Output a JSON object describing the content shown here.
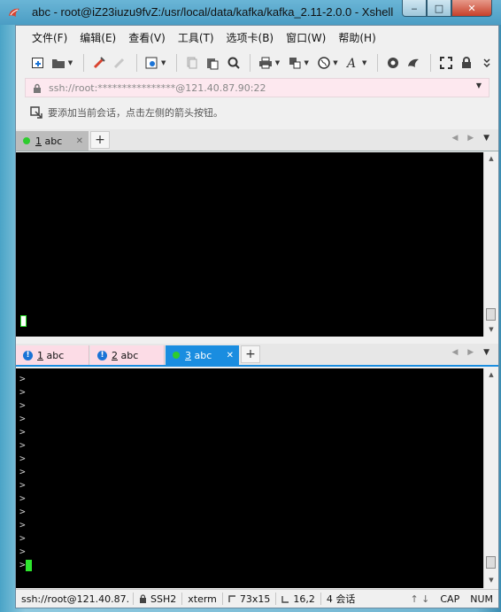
{
  "window": {
    "title": "abc - root@iZ23iuzu9fvZ:/usr/local/data/kafka/kafka_2.11-2.0.0 - Xshell",
    "buttons": {
      "minimize": "‒",
      "maximize": "□",
      "close": "✕"
    }
  },
  "menu": [
    "文件(F)",
    "编辑(E)",
    "查看(V)",
    "工具(T)",
    "选项卡(B)",
    "窗口(W)",
    "帮助(H)"
  ],
  "toolbar": {
    "icons": [
      "new-session-icon",
      "open-folder-icon",
      "reconnect-icon",
      "disconnect-icon",
      "properties-icon",
      "copy-icon",
      "paste-icon",
      "find-icon",
      "print-icon",
      "transfer-icon",
      "globe-icon",
      "font-icon",
      "xftp-icon",
      "xagent-icon",
      "fullscreen-icon",
      "lock-icon",
      "more-icon"
    ]
  },
  "address": {
    "value": "ssh://root:****************@121.40.87.90:22"
  },
  "hint": {
    "text": "要添加当前会话，点击左侧的箭头按钮。"
  },
  "top_pane": {
    "tabs": [
      {
        "number": "1",
        "label": "abc",
        "status": "connected"
      }
    ],
    "add_tab": "+"
  },
  "bottom_pane": {
    "tabs": [
      {
        "number": "1",
        "label": "abc",
        "status": "warning"
      },
      {
        "number": "2",
        "label": "abc",
        "status": "warning"
      },
      {
        "number": "3",
        "label": "abc",
        "status": "connected"
      }
    ],
    "add_tab": "+",
    "prompt_lines": [
      ">",
      ">",
      ">",
      ">",
      ">",
      ">",
      ">",
      ">",
      ">",
      ">",
      ">",
      ">",
      ">",
      ">",
      ">"
    ]
  },
  "status": {
    "connection": "ssh://root@121.40.87.",
    "protocol": "SSH2",
    "terminal": "xterm",
    "size": "73x15",
    "position": "16,2",
    "sessions": "4 会话",
    "caps": "CAP",
    "num": "NUM"
  },
  "colors": {
    "accent": "#1a8de0",
    "cursor": "#2ee62e",
    "warning": "#1a73d6"
  }
}
